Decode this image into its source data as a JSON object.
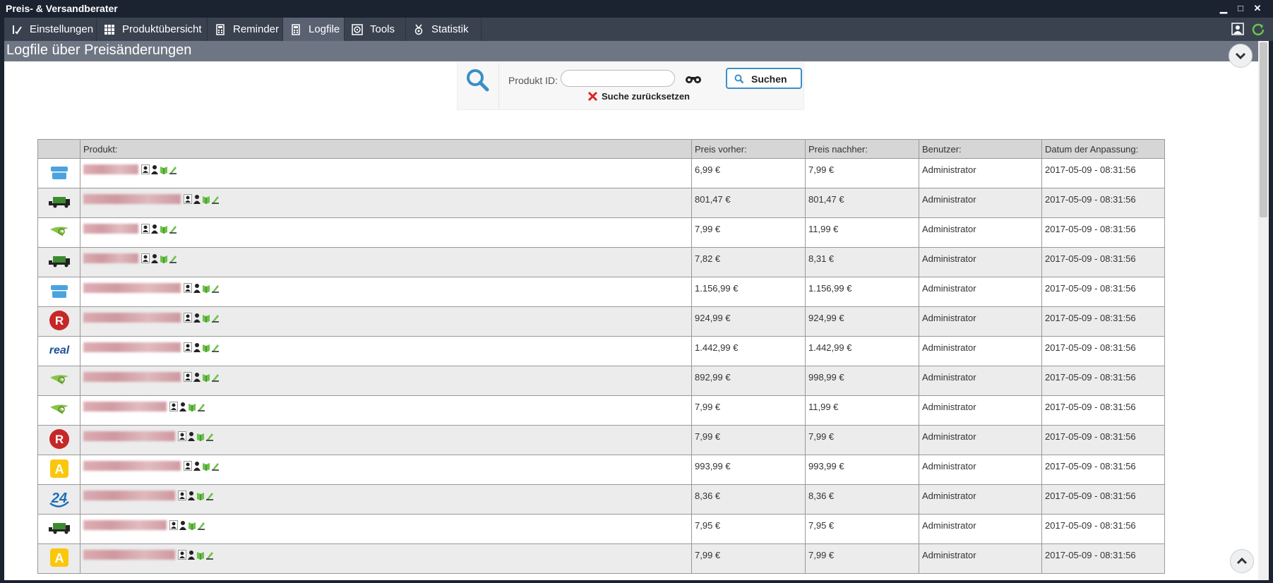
{
  "window": {
    "title": "Preis- & Versandberater"
  },
  "menu": {
    "items": [
      {
        "key": "einstellungen",
        "label": "Einstellungen",
        "icon": "settings-list-icon"
      },
      {
        "key": "produktuebersicht",
        "label": "Produktübersicht",
        "icon": "grid-icon"
      },
      {
        "key": "reminder",
        "label": "Reminder",
        "icon": "calculator-icon"
      },
      {
        "key": "logfile",
        "label": "Logfile",
        "icon": "calculator-icon",
        "active": true
      },
      {
        "key": "tools",
        "label": "Tools",
        "icon": "disc-icon"
      },
      {
        "key": "statistik",
        "label": "Statistik",
        "icon": "medal-icon"
      }
    ]
  },
  "panel": {
    "title": "Logfile über Preisänderungen"
  },
  "search": {
    "label": "Produkt ID:",
    "value": "",
    "placeholder": "",
    "button_label": "Suchen",
    "reset_label": "Suche zurücksetzen"
  },
  "table": {
    "headers": [
      "",
      "Produkt:",
      "Preis vorher:",
      "Preis nachher:",
      "Benutzer:",
      "Datum der Anpassung:"
    ],
    "rows": [
      {
        "shop": "box-shop",
        "before": "6,99 €",
        "after": "7,99 €",
        "user": "Administrator",
        "date": "2017-05-09 - 08:31:56"
      },
      {
        "shop": "truck-shop",
        "before": "801,47 €",
        "after": "801,47 €",
        "user": "Administrator",
        "date": "2017-05-09 - 08:31:56"
      },
      {
        "shop": "bird-shop",
        "before": "7,99 €",
        "after": "11,99 €",
        "user": "Administrator",
        "date": "2017-05-09 - 08:31:56"
      },
      {
        "shop": "truck-shop",
        "before": "7,82 €",
        "after": "8,31 €",
        "user": "Administrator",
        "date": "2017-05-09 - 08:31:56"
      },
      {
        "shop": "box-shop",
        "before": "1.156,99 €",
        "after": "1.156,99 €",
        "user": "Administrator",
        "date": "2017-05-09 - 08:31:56"
      },
      {
        "shop": "r-shop",
        "before": "924,99 €",
        "after": "924,99 €",
        "user": "Administrator",
        "date": "2017-05-09 - 08:31:56"
      },
      {
        "shop": "real-shop",
        "before": "1.442,99 €",
        "after": "1.442,99 €",
        "user": "Administrator",
        "date": "2017-05-09 - 08:31:56"
      },
      {
        "shop": "bird-shop",
        "before": "892,99 €",
        "after": "998,99 €",
        "user": "Administrator",
        "date": "2017-05-09 - 08:31:56"
      },
      {
        "shop": "bird-shop",
        "before": "7,99 €",
        "after": "11,99 €",
        "user": "Administrator",
        "date": "2017-05-09 - 08:31:56"
      },
      {
        "shop": "r-shop",
        "before": "7,99 €",
        "after": "7,99 €",
        "user": "Administrator",
        "date": "2017-05-09 - 08:31:56"
      },
      {
        "shop": "a-shop",
        "before": "993,99 €",
        "after": "993,99 €",
        "user": "Administrator",
        "date": "2017-05-09 - 08:31:56"
      },
      {
        "shop": "24-shop",
        "before": "8,36 €",
        "after": "8,36 €",
        "user": "Administrator",
        "date": "2017-05-09 - 08:31:56"
      },
      {
        "shop": "truck-shop",
        "before": "7,95 €",
        "after": "7,95 €",
        "user": "Administrator",
        "date": "2017-05-09 - 08:31:56"
      },
      {
        "shop": "a-shop",
        "before": "7,99 €",
        "after": "7,99 €",
        "user": "Administrator",
        "date": "2017-05-09 - 08:31:56"
      }
    ]
  },
  "colors": {
    "titlebar": "#1b2230",
    "menubar": "#3a4250",
    "menu_active": "#5a6272",
    "panel_header": "#6f7683",
    "accent_blue": "#3a8fc7",
    "reset_red": "#e02020"
  }
}
